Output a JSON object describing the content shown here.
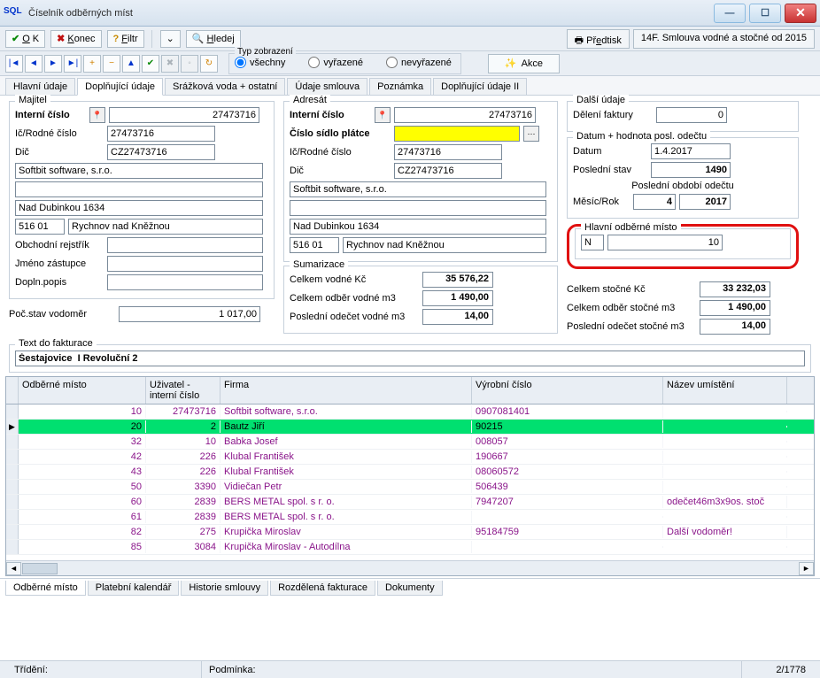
{
  "window": {
    "title": "Číselník odběrných míst"
  },
  "toolbar1": {
    "ok": "OK",
    "konec": "Konec",
    "filtr": "Filtr",
    "hledej": "Hledej",
    "predtisk": "Předtisk",
    "smlouva": "14F. Smlouva vodné a stočné od 2015"
  },
  "toolbar2": {
    "type_legend": "Typ zobrazení",
    "vsechny": "všechny",
    "vyrazene": "vyřazené",
    "nevyrazene": "nevyřazené",
    "akce": "Akce"
  },
  "tabs": {
    "t1": "Hlavní údaje",
    "t2": "Doplňující údaje",
    "t3": "Srážková voda + ostatní",
    "t4": "Údaje smlouva",
    "t5": "Poznámka",
    "t6": "Doplňující údaje II"
  },
  "majitel": {
    "legend": "Majitel",
    "interni_cislo_lbl": "Interní číslo",
    "interni_cislo": "27473716",
    "ic_lbl": "Ič/Rodné číslo",
    "ic": "27473716",
    "dic_lbl": "Dič",
    "dic": "CZ27473716",
    "firma": "Softbit software, s.r.o.",
    "adr2": "",
    "adr3": "Nad Dubinkou 1634",
    "psc": "516 01",
    "mesto": "Rychnov nad Kněžnou",
    "or_lbl": "Obchodní rejstřík",
    "or": "",
    "zastupce_lbl": "Jméno zástupce",
    "zastupce": "",
    "dopln_lbl": "Dopln.popis",
    "dopln": ""
  },
  "adresat": {
    "legend": "Adresát",
    "interni_cislo_lbl": "Interní číslo",
    "interni_cislo": "27473716",
    "sidlo_lbl": "Číslo sídlo plátce",
    "sidlo": "",
    "ic_lbl": "Ič/Rodné číslo",
    "ic": "27473716",
    "dic_lbl": "Dič",
    "dic": "CZ27473716",
    "firma": "Softbit software, s.r.o.",
    "adr2": "",
    "adr3": "Nad Dubinkou 1634",
    "psc": "516 01",
    "mesto": "Rychnov nad Kněžnou"
  },
  "dalsi": {
    "legend": "Další údaje",
    "deleni_lbl": "Dělení faktury",
    "deleni": "0"
  },
  "odecet": {
    "legend": "Datum + hodnota posl. odečtu",
    "datum_lbl": "Datum",
    "datum": "1.4.2017",
    "stav_lbl": "Poslední stav",
    "stav": "1490",
    "obdobi_lbl": "Poslední období odečtu",
    "mr_lbl": "Měsíc/Rok",
    "mesic": "4",
    "rok": "2017"
  },
  "hlavni_om": {
    "legend": "Hlavní odběrné místo",
    "f1": "N",
    "f2": "10"
  },
  "sumarizace": {
    "legend": "Sumarizace",
    "vodne_kc_lbl": "Celkem vodné Kč",
    "vodne_kc": "35 576,22",
    "odber_vodne_lbl": "Celkem odběr vodné m3",
    "odber_vodne": "1 490,00",
    "posledni_vodne_lbl": "Poslední odečet vodné m3",
    "posledni_vodne": "14,00",
    "stocne_kc_lbl": "Celkem stočné Kč",
    "stocne_kc": "33 232,03",
    "odber_stocne_lbl": "Celkem odběr stočné m3",
    "odber_stocne": "1 490,00",
    "posledni_stocne_lbl": "Poslední odečet stočné m3",
    "posledni_stocne": "14,00"
  },
  "poc_stav": {
    "lbl": "Poč.stav vodoměr",
    "val": "1 017,00"
  },
  "text_fakt": {
    "legend": "Text do fakturace",
    "val": "Šestajovice  I Revoluční 2"
  },
  "grid": {
    "h1": "Odběrné místo",
    "h2": "Uživatel - interní číslo",
    "h3": "Firma",
    "h4": "Výrobní číslo",
    "h5": "Název umístění",
    "rows": [
      {
        "om": "10",
        "uic": "27473716",
        "firma": "Softbit software, s.r.o.",
        "vc": "0907081401",
        "nu": ""
      },
      {
        "om": "20",
        "uic": "2",
        "firma": "Bautz Jiří",
        "vc": "90215",
        "nu": ""
      },
      {
        "om": "32",
        "uic": "10",
        "firma": "Babka Josef",
        "vc": "008057",
        "nu": ""
      },
      {
        "om": "42",
        "uic": "226",
        "firma": "Klubal František",
        "vc": "190667",
        "nu": ""
      },
      {
        "om": "43",
        "uic": "226",
        "firma": "Klubal František",
        "vc": "08060572",
        "nu": ""
      },
      {
        "om": "50",
        "uic": "3390",
        "firma": "Vidiečan Petr",
        "vc": "506439",
        "nu": ""
      },
      {
        "om": "60",
        "uic": "2839",
        "firma": "BERS METAL spol. s r. o.",
        "vc": "7947207",
        "nu": "odečet46m3x9os. stoč"
      },
      {
        "om": "61",
        "uic": "2839",
        "firma": "BERS METAL spol. s r. o.",
        "vc": "",
        "nu": ""
      },
      {
        "om": "82",
        "uic": "275",
        "firma": "Krupička Miroslav",
        "vc": "95184759",
        "nu": "Další vodoměr!"
      },
      {
        "om": "85",
        "uic": "3084",
        "firma": "Krupička Miroslav - Autodílna",
        "vc": "",
        "nu": ""
      }
    ]
  },
  "bottomtabs": {
    "t1": "Odběrné místo",
    "t2": "Platební kalendář",
    "t3": "Historie smlouvy",
    "t4": "Rozdělená fakturace",
    "t5": "Dokumenty"
  },
  "status": {
    "trideni": "Třídění:",
    "podminka": "Podmínka:",
    "count": "2/1778"
  }
}
